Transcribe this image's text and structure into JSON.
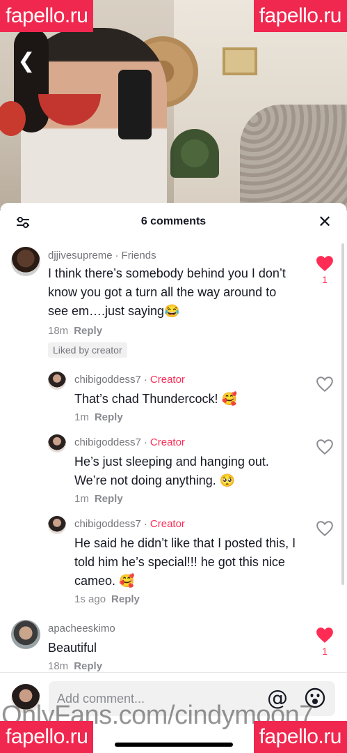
{
  "watermarks": {
    "site": "fapello.ru",
    "onlyfans": "OnlyFans.com/cindymoon7"
  },
  "sheet": {
    "title": "6 comments"
  },
  "comments": [
    {
      "user": "djjivesupreme",
      "tag": "Friends",
      "text": "I think there’s somebody behind you I don’t know you got a turn all the way around to see em….just saying😂",
      "time": "18m",
      "reply": "Reply",
      "liked_by_creator": "Liked by creator",
      "likes": "1"
    },
    {
      "user": "chibigoddess7",
      "tag": "Creator",
      "text": "That’s chad Thundercock! 🥰",
      "time": "1m",
      "reply": "Reply"
    },
    {
      "user": "chibigoddess7",
      "tag": "Creator",
      "text": "He’s just sleeping and hanging out. We’re not doing anything. 🥺",
      "time": "1m",
      "reply": "Reply"
    },
    {
      "user": "chibigoddess7",
      "tag": "Creator",
      "text": "He said he didn’t like that I posted this, I told him he’s special!!! he got this nice cameo. 🥰",
      "time": "1s ago",
      "reply": "Reply"
    },
    {
      "user": "apacheeskimo",
      "text": "Beautiful",
      "time": "18m",
      "reply": "Reply",
      "likes": "1"
    }
  ],
  "input": {
    "placeholder": "Add comment..."
  },
  "icons": {
    "back": "chevron-left-icon",
    "filter": "sliders-icon",
    "close": "close-icon",
    "heart": "heart-icon",
    "mention": "at-sign-icon",
    "emoji": "smiley-icon"
  },
  "colors": {
    "accent": "#fe2c55",
    "watermark": "#f0284f",
    "text": "#161823",
    "muted": "#8a8b91"
  }
}
